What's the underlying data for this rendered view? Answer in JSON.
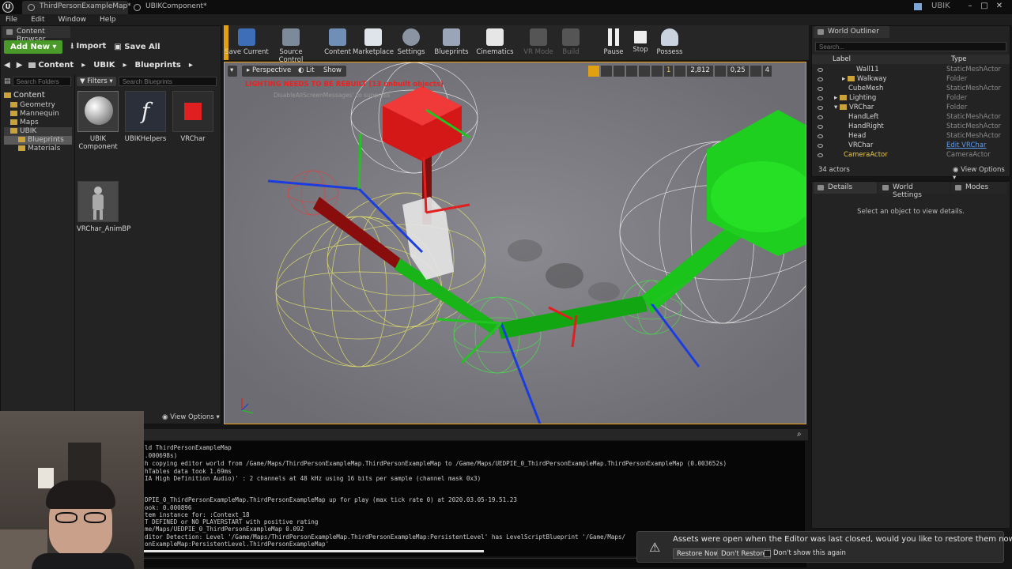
{
  "titlebar": {
    "tabs": [
      "ThirdPersonExampleMap*",
      "UBIKComponent*"
    ],
    "project": "UBIK"
  },
  "menu": [
    "File",
    "Edit",
    "Window",
    "Help"
  ],
  "content_browser": {
    "tab": "Content Browser",
    "add_new": "Add New",
    "import": "Import",
    "save_all": "Save All",
    "breadcrumbs": [
      "Content",
      "UBIK",
      "Blueprints"
    ],
    "search_folders_placeholder": "Search Folders",
    "filters": "Filters",
    "search_placeholder": "Search Blueprints",
    "tree": [
      {
        "label": "Content",
        "level": 0
      },
      {
        "label": "Geometry",
        "level": 1
      },
      {
        "label": "Mannequin",
        "level": 1
      },
      {
        "label": "Maps",
        "level": 1
      },
      {
        "label": "UBIK",
        "level": 1
      },
      {
        "label": "Blueprints",
        "level": 2
      },
      {
        "label": "Materials",
        "level": 2
      }
    ],
    "assets": [
      "UBIK Component",
      "UBIKHelpers",
      "VRChar",
      "VRChar_AnimBP"
    ],
    "view_options": "View Options"
  },
  "toolbar": {
    "buttons": [
      "Save Current",
      "Source Control",
      "Content",
      "Marketplace",
      "Settings",
      "Blueprints",
      "Cinematics",
      "VR Mode",
      "Build",
      "Pause",
      "Stop",
      "Possess"
    ]
  },
  "viewport": {
    "perspective": "Perspective",
    "lit": "Lit",
    "show": "Show",
    "warning": "LIGHTING NEEDS TO BE REBUILT (13 unbuilt objects)",
    "sub_warning": "DisableAllScreenMessages' to suppress",
    "fov": "2,812",
    "speed": "0,25",
    "grid": "1",
    "cam_speed": "4"
  },
  "world_outliner": {
    "tab": "World Outliner",
    "search_placeholder": "Search...",
    "col_label": "Label",
    "col_type": "Type",
    "rows": [
      {
        "label": "Wall11",
        "type": "StaticMeshActor",
        "indent": 3
      },
      {
        "label": "Walkway",
        "type": "Folder",
        "indent": 2
      },
      {
        "label": "CubeMesh",
        "type": "StaticMeshActor",
        "indent": 2
      },
      {
        "label": "Lighting",
        "type": "Folder",
        "indent": 1
      },
      {
        "label": "VRChar",
        "type": "Folder",
        "indent": 1
      },
      {
        "label": "HandLeft",
        "type": "StaticMeshActor",
        "indent": 2
      },
      {
        "label": "HandRight",
        "type": "StaticMeshActor",
        "indent": 2
      },
      {
        "label": "Head",
        "type": "StaticMeshActor",
        "indent": 2
      },
      {
        "label": "VRChar",
        "type": "Edit VRChar",
        "indent": 2
      },
      {
        "label": "CameraActor",
        "type": "CameraActor",
        "indent": 1
      }
    ],
    "count": "34 actors",
    "view_options": "View Options"
  },
  "details": {
    "tabs": [
      "Details",
      "World Settings",
      "Modes"
    ],
    "empty": "Select an object to view details."
  },
  "log": {
    "lines": [
      "ld ThirdPersonExampleMap",
      ".000698s)",
      "h copying editor world from /Game/Maps/ThirdPersonExampleMap.ThirdPersonExampleMap to /Game/Maps/UEDPIE_0_ThirdPersonExampleMap.ThirdPersonExampleMap (0.003652s)",
      "hTables data took   1.69ms",
      "IA High Definition Audio)' : 2 channels at 48 kHz using 16 bits per sample (channel mask 0x3)",
      "",
      "",
      "DPIE_0_ThirdPersonExampleMap.ThirdPersonExampleMap up for play (max tick rate 0) at 2020.03.05-19.51.23",
      "ook: 0.000896",
      "tem instance for: :Context_18",
      "T DEFINED or NO PLAYERSTART with positive rating",
      "me/Maps/UEDPIE_0_ThirdPersonExampleMap 0.092",
      "ditor Detection: Level '/Game/Maps/ThirdPersonExampleMap.ThirdPersonExampleMap:PersistentLevel' has LevelScriptBlueprint '/Game/Maps/",
      "onExampleMap:PersistentLevel.ThirdPersonExampleMap'"
    ]
  },
  "notification": {
    "message": "Assets were open when the Editor was last closed, would you like to restore them now?",
    "restore": "Restore Now",
    "dont_restore": "Don't Restore",
    "dont_show": "Don't show this again"
  }
}
